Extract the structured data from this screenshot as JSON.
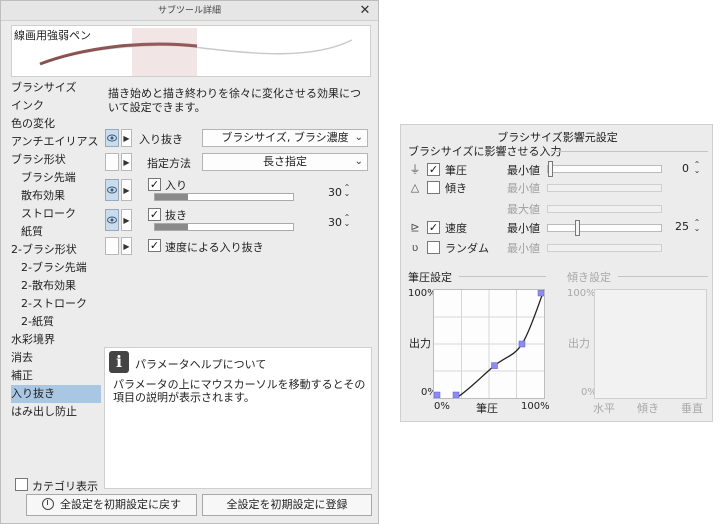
{
  "left": {
    "window_title": "サブツール詳細",
    "close_label": "✕",
    "brush_name": "線画用強弱ペン",
    "categories": [
      {
        "label": "ブラシサイズ",
        "sub": false
      },
      {
        "label": "インク",
        "sub": false
      },
      {
        "label": "色の変化",
        "sub": false
      },
      {
        "label": "アンチエイリアス",
        "sub": false
      },
      {
        "label": "ブラシ形状",
        "sub": false
      },
      {
        "label": "ブラシ先端",
        "sub": true
      },
      {
        "label": "散布効果",
        "sub": true
      },
      {
        "label": "ストローク",
        "sub": true
      },
      {
        "label": "紙質",
        "sub": true
      },
      {
        "label": "2-ブラシ形状",
        "sub": false
      },
      {
        "label": "2-ブラシ先端",
        "sub": true
      },
      {
        "label": "2-散布効果",
        "sub": true
      },
      {
        "label": "2-ストローク",
        "sub": true
      },
      {
        "label": "2-紙質",
        "sub": true
      },
      {
        "label": "水彩境界",
        "sub": false
      },
      {
        "label": "消去",
        "sub": false
      },
      {
        "label": "補正",
        "sub": false
      },
      {
        "label": "入り抜き",
        "sub": false,
        "selected": true
      },
      {
        "label": "はみ出し防止",
        "sub": false
      }
    ],
    "description": "描き始めと描き終わりを徐々に変化させる効果について設定できます。",
    "props": {
      "entry_exit_label": "入り抜き",
      "entry_exit_value": "ブラシサイズ, ブラシ濃度",
      "method_label": "指定方法",
      "method_value": "長さ指定",
      "entry_label": "入り",
      "entry_value": "30",
      "entry_fill": 0.24,
      "exit_label": "抜き",
      "exit_value": "30",
      "exit_fill": 0.24,
      "speed_label": "速度による入り抜き"
    },
    "help": {
      "icon": "i",
      "title": "パラメータヘルプについて",
      "body": "パラメータの上にマウスカーソルを移動するとその項目の説明が表示されます。"
    },
    "category_display_label": "カテゴリ表示",
    "reset_button": "全設定を初期設定に戻す",
    "register_button": "全設定を初期設定に登録"
  },
  "right": {
    "title": "ブラシサイズ影響元設定",
    "affect_label": "ブラシサイズに影響させる入力",
    "inputs": {
      "pressure": {
        "name": "筆圧",
        "checked": true,
        "min_label": "最小値",
        "value": "0",
        "level": 0
      },
      "tilt": {
        "name": "傾き",
        "checked": false,
        "min_label": "最小値",
        "max_label": "最大値"
      },
      "speed": {
        "name": "速度",
        "checked": true,
        "min_label": "最小値",
        "value": "25",
        "level": 0.25
      },
      "random": {
        "name": "ランダム",
        "checked": false,
        "min_label": "最小値"
      }
    },
    "pressure_graph": {
      "title": "筆圧設定",
      "y_top": "100%",
      "y_label": "出力",
      "y_bottom": "0%",
      "x_left": "0%",
      "x_label": "筆圧",
      "x_right": "100%",
      "points": [
        [
          0,
          0
        ],
        [
          20,
          0
        ],
        [
          55,
          30
        ],
        [
          80,
          50
        ],
        [
          100,
          100
        ]
      ]
    },
    "tilt_graph": {
      "title": "傾き設定",
      "y_top": "100%",
      "y_label": "出力",
      "y_bottom": "0%",
      "x_left": "水平",
      "x_mid": "傾き",
      "x_right": "垂直"
    },
    "check_mark": "✓"
  }
}
